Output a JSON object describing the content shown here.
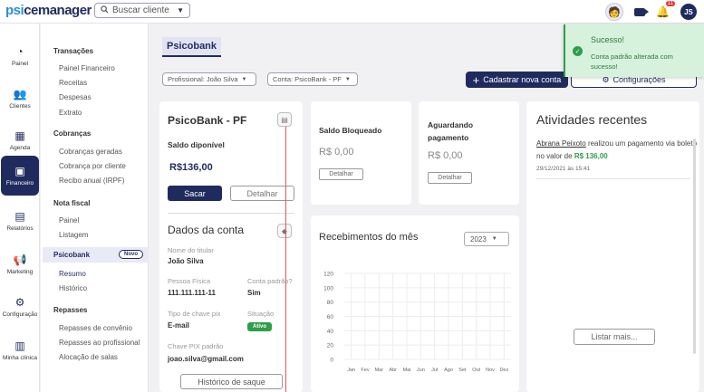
{
  "header": {
    "logo_psi": "psi",
    "logo_rest": "cemanager",
    "search_placeholder": "Buscar cliente",
    "notification_count": "11",
    "avatar_initials": "JS"
  },
  "rail": [
    {
      "key": "painel",
      "label": "Painel",
      "icon": "dashboard-icon"
    },
    {
      "key": "clientes",
      "label": "Clientes",
      "icon": "users-icon"
    },
    {
      "key": "agenda",
      "label": "Agenda",
      "icon": "calendar-icon"
    },
    {
      "key": "financeiro",
      "label": "Financeiro",
      "icon": "money-icon",
      "active": true
    },
    {
      "key": "relatorios",
      "label": "Relatórios",
      "icon": "document-icon"
    },
    {
      "key": "marketing",
      "label": "Marketing",
      "icon": "megaphone-icon"
    },
    {
      "key": "configuracao",
      "label": "Configuração",
      "icon": "gear-icon"
    },
    {
      "key": "minha_clinica",
      "label": "Minha clínica",
      "icon": "building-icon"
    }
  ],
  "submenu": {
    "transacoes": "Transações",
    "painel_financeiro": "Painel Financeiro",
    "receitas": "Receitas",
    "despesas": "Despesas",
    "extrato": "Extrato",
    "cobrancas": "Cobranças",
    "cobrancas_geradas": "Cobranças geradas",
    "cobranca_cliente": "Cobrança por cliente",
    "recibo_anual": "Recibo anual (IRPF)",
    "nota_fiscal": "Nota fiscal",
    "nf_painel": "Painel",
    "nf_listagem": "Listagem",
    "psicobank": "Psicobank",
    "novo_badge": "Novo",
    "resumo": "Resumo",
    "historico": "Histórico",
    "repasses": "Repasses",
    "repasses_convenio": "Repasses de convênio",
    "repasses_profissional": "Repasses ao profissional",
    "alocacao_salas": "Alocação de salas"
  },
  "page": {
    "title": "Psicobank",
    "profissional_select": "Profissional: João Silva",
    "conta_select": "Conta: PsicoBank - PF",
    "cadastrar_button": "Cadastrar nova conta",
    "config_button": "Configurações"
  },
  "account_card": {
    "title": "PsicoBank - PF",
    "saldo_label": "Saldo diponível",
    "saldo_value": "R$136,00",
    "sacar": "Sacar",
    "detalhar": "Detalhar"
  },
  "dados": {
    "title": "Dados da conta",
    "nome_label": "Nome do titular",
    "nome_value": "João Silva",
    "pessoa_label": "Pessoa Física",
    "pessoa_value": "111.111.111-11",
    "padrao_label": "Conta padrão?",
    "padrao_value": "Sim",
    "tipo_label": "Tipo de chave pix",
    "tipo_value": "E-mail",
    "situacao_label": "Situação",
    "situacao_value": "Ativo",
    "chave_label": "Chave PIX padrão",
    "chave_value": "joao.silva@gmail.com",
    "historico_button": "Histórico de saque"
  },
  "bloqueado": {
    "title": "Saldo Bloqueado",
    "value": "R$ 0,00",
    "button": "Detalhar"
  },
  "aguardando": {
    "title": "Aguardando pagamento",
    "value": "R$ 0,00",
    "button": "Detalhar"
  },
  "recebimentos": {
    "title": "Recebimentos do mês",
    "year": "2023"
  },
  "chart_data": {
    "type": "line",
    "title": "Recebimentos do mês",
    "categories": [
      "Jan",
      "Fev",
      "Mar",
      "Abr",
      "Mai",
      "Jun",
      "Jul",
      "Ago",
      "Set",
      "Out",
      "Nov",
      "Dez"
    ],
    "y_ticks": [
      "0",
      "20",
      "40",
      "60",
      "80",
      "100",
      "120"
    ],
    "ylim": [
      0,
      120
    ],
    "grid": true,
    "series": []
  },
  "atividades": {
    "title": "Atividades recentes",
    "item_name": "Abrana Peixoto",
    "item_text_1": "realizou um pagamento via boleto no valor de",
    "item_amount": "R$ 136,00",
    "item_date": "29/12/2021 às 15:41",
    "listar_mais": "Listar mais..."
  },
  "toast": {
    "title": "Sucesso!",
    "message": "Conta padrão alterada com sucesso!"
  },
  "colors": {
    "brand": "#1f2b5e",
    "success": "#2e9e4a",
    "accent_blue": "#2a8fd6"
  }
}
